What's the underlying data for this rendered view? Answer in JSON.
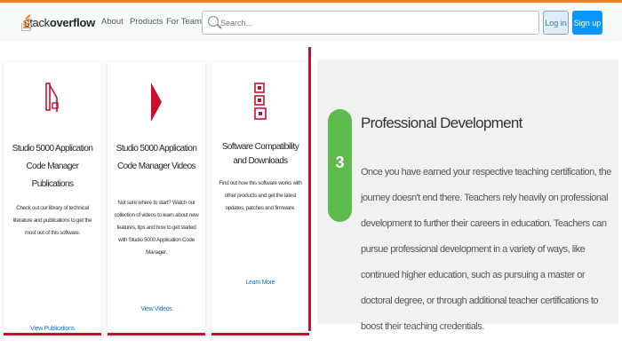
{
  "header": {
    "logo_prefix": "stack",
    "logo_bold": "overflow",
    "nav": [
      "About",
      "Products",
      "For Teams"
    ],
    "search_placeholder": "Search...",
    "login_label": "Log in",
    "signup_label": "Sign up",
    "accent_color": "#f48024"
  },
  "cards": [
    {
      "icon": "document-icon",
      "title": "Studio 5000 Application Code Manager Publications",
      "body": "Check out our library of technical literature and publications to get the most out of this software.",
      "link": "View Publications"
    },
    {
      "icon": "play-icon",
      "title": "Studio 5000 Application Code Manager Videos",
      "body": "Not sure where to start? Watch our collection of videos to learn about new features, tips and how to get started with Studio 5000 Application Code Manager.",
      "link": "View Videos"
    },
    {
      "icon": "qr-code-icon",
      "title": "Software Compatibility and Downloads",
      "body": "Find out how this software works with other products and get the latest updates, patches and firmware.",
      "link": "Learn More"
    }
  ],
  "step": {
    "number": "3",
    "title": "Professional Development",
    "body": "Once you have earned your respective teaching certification, the journey doesn't end there. Teachers rely heavily on professional development to further their careers in education. Teachers can pursue professional development in a variety of ways, like continued higher education, such as pursuing a master or doctoral degree, or through additional teacher certifications to boost their teaching credentials.",
    "accent_color": "#5bbb4b"
  },
  "brand_red": "#c8102e"
}
